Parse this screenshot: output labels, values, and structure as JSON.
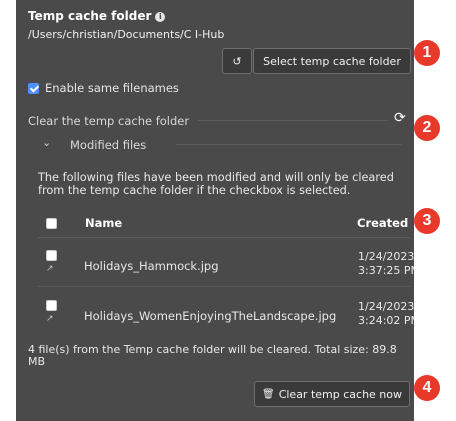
{
  "header": {
    "title": "Temp cache folder",
    "path": "/Users/christian/Documents/C I-Hub",
    "select_button": "Select temp cache folder",
    "reset_icon": "↺"
  },
  "enable_same_filenames": {
    "label": "Enable same filenames",
    "checked": true
  },
  "clear_section": {
    "label": "Clear the temp cache folder",
    "refresh_icon": "⟳"
  },
  "modified": {
    "toggle_label": "Modified files",
    "chevron": "⌄",
    "description": "The following files have been modified and will only be cleared from the temp cache folder if the checkbox is selected."
  },
  "table": {
    "columns": {
      "name": "Name",
      "created": "Created"
    },
    "rows": [
      {
        "name": "Holidays_Hammock.jpg",
        "date": "1/24/2023",
        "time": "3:37:25 PM",
        "checked": false
      },
      {
        "name": "Holidays_WomenEnjoyingTheLandscape.jpg",
        "date": "1/24/2023",
        "time": "3:24:02 PM",
        "checked": false
      }
    ]
  },
  "summary": "4 file(s) from the Temp cache folder will be cleared. Total size: 89.8 MB",
  "clear_button": {
    "icon": "🗑",
    "label": "Clear temp cache now"
  },
  "markers": [
    "1",
    "2",
    "3",
    "4"
  ],
  "colors": {
    "panel": "#4a4a4a",
    "marker": "#e8392b",
    "checkbox_accent": "#4d90fe"
  }
}
